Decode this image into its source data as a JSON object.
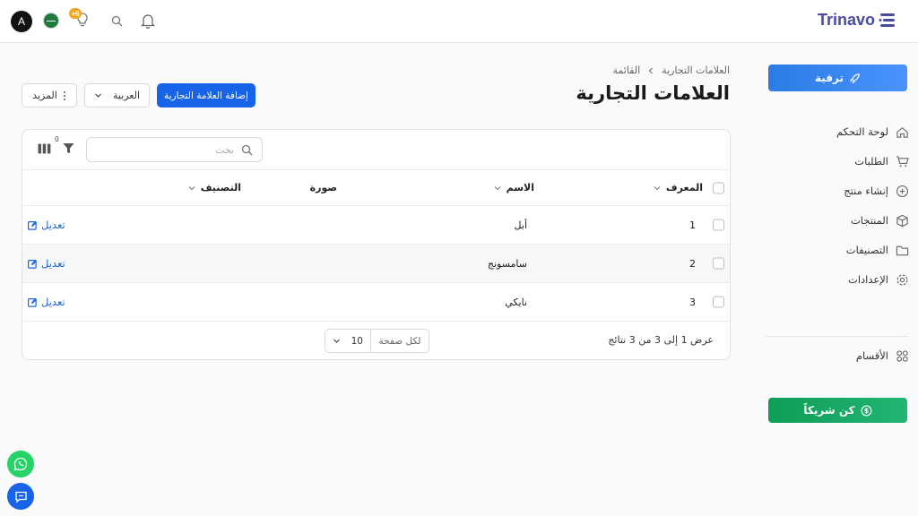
{
  "topbar": {
    "logo_text": "Trinavo",
    "avatar_letter": "A",
    "notification_badge": "+6",
    "icons": [
      "language-flag-icon",
      "lightbulb-icon",
      "search-icon",
      "bell-icon"
    ]
  },
  "sidebar": {
    "upgrade_label": "ترقية",
    "items": [
      {
        "label": "لوحة التحكم",
        "icon": "home-icon"
      },
      {
        "label": "الطلبات",
        "icon": "cart-icon"
      },
      {
        "label": "إنشاء منتج",
        "icon": "plus-circle-icon"
      },
      {
        "label": "المنتجات",
        "icon": "box-icon"
      },
      {
        "label": "التصنيفات",
        "icon": "folder-icon"
      },
      {
        "label": "الإعدادات",
        "icon": "gear-icon"
      }
    ],
    "sections_label": "الأقسام",
    "partner_label": "كن شريكاً"
  },
  "header": {
    "breadcrumb": [
      "العلامات التجارية",
      "القائمة"
    ],
    "title": "العلامات التجارية",
    "add_label": "إضافة العلامة التجارية",
    "language_value": "العربية",
    "more_label": "المزيد"
  },
  "table": {
    "search_placeholder": "بحث",
    "filter_count": "0",
    "columns": {
      "id": "المعرف",
      "name": "الاسم",
      "image": "صورة",
      "category": "التصنيف"
    },
    "rows": [
      {
        "id": "1",
        "name": "أبل",
        "edit": "تعديل"
      },
      {
        "id": "2",
        "name": "سامسونج",
        "edit": "تعديل"
      },
      {
        "id": "3",
        "name": "نايكي",
        "edit": "تعديل"
      }
    ],
    "summary": "عرض 1 إلى 3 من 3 نتائج",
    "per_page_label": "لكل صفحة",
    "per_page_value": "10"
  },
  "colors": {
    "primary": "#1764e8",
    "upgrade": "#2c7be5",
    "partner": "#0f9d58",
    "logo": "#4b4aa3",
    "badge": "#f5a524"
  }
}
